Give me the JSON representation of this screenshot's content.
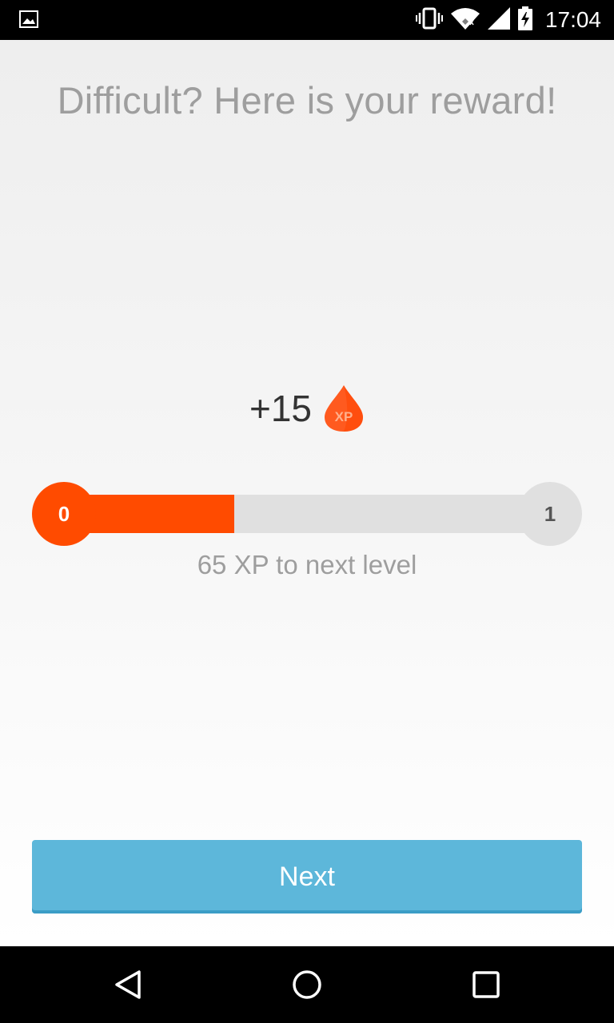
{
  "status_bar": {
    "time": "17:04",
    "icons": [
      "image-notification-icon",
      "vibrate-icon",
      "wifi-icon",
      "cell-signal-icon",
      "battery-charging-icon"
    ]
  },
  "title": "Difficult? Here is your reward!",
  "reward": {
    "amount": "+15",
    "icon": "xp-drop-icon",
    "icon_label": "XP"
  },
  "progress": {
    "current_level": "0",
    "next_level": "1",
    "fraction": 0.35,
    "caption": "65 XP to next level"
  },
  "next_button": {
    "label": "Next"
  },
  "nav_bar": {
    "icons": [
      "back-icon",
      "home-icon",
      "recents-icon"
    ]
  },
  "colors": {
    "accent": "#ff4b00",
    "button": "#5db7da",
    "track": "#e0e0e0",
    "title_text": "#9e9e9e"
  }
}
